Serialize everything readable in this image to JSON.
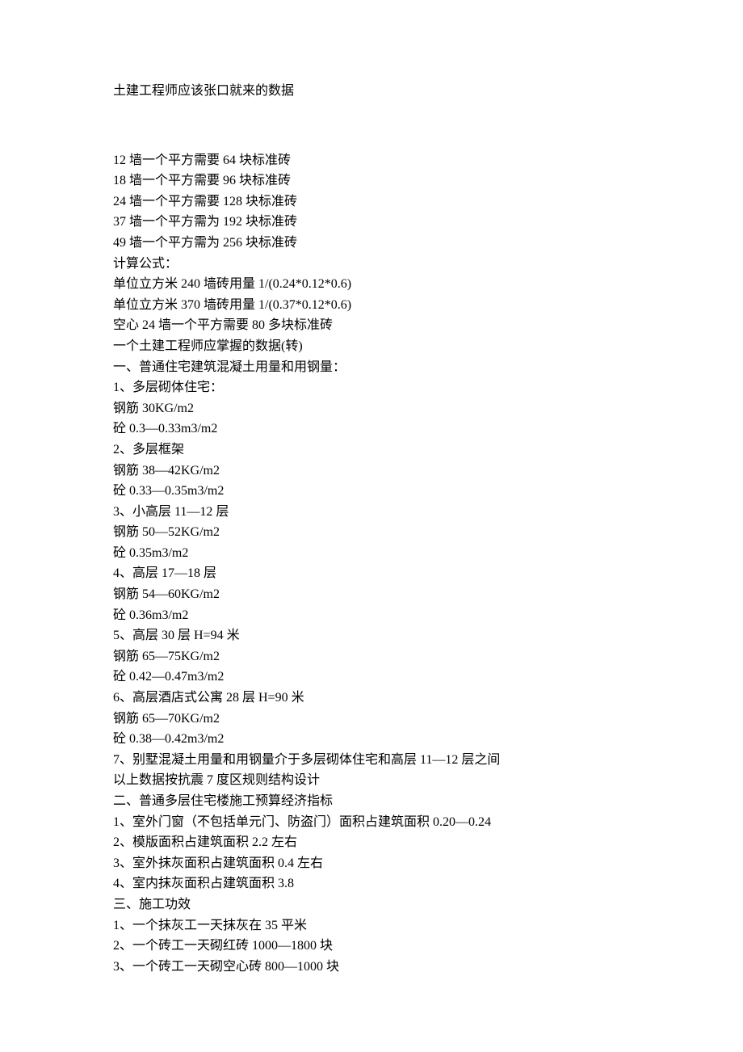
{
  "title": "土建工程师应该张口就来的数据",
  "lines": [
    "12 墙一个平方需要 64 块标准砖",
    "18 墙一个平方需要 96 块标准砖",
    "24 墙一个平方需要 128 块标准砖",
    "37 墙一个平方需为 192 块标准砖",
    "49 墙一个平方需为 256 块标准砖",
    "计算公式：",
    "单位立方米 240 墙砖用量 1/(0.24*0.12*0.6)",
    "单位立方米 370 墙砖用量 1/(0.37*0.12*0.6)",
    "空心 24 墙一个平方需要 80 多块标准砖",
    "一个土建工程师应掌握的数据(转)",
    "一、普通住宅建筑混凝土用量和用钢量：",
    "1、多层砌体住宅：",
    "钢筋 30KG/m2",
    "砼 0.3—0.33m3/m2",
    "2、多层框架",
    "钢筋 38—42KG/m2",
    "砼 0.33—0.35m3/m2",
    "3、小高层 11—12 层",
    "钢筋 50—52KG/m2",
    "砼 0.35m3/m2",
    "4、高层 17—18 层",
    "钢筋 54—60KG/m2",
    "砼 0.36m3/m2",
    "5、高层 30 层 H=94 米",
    "钢筋 65—75KG/m2",
    "砼 0.42—0.47m3/m2",
    "6、高层酒店式公寓 28 层 H=90 米",
    "钢筋 65—70KG/m2",
    "砼 0.38—0.42m3/m2",
    "7、别墅混凝土用量和用钢量介于多层砌体住宅和高层 11—12 层之间",
    "以上数据按抗震 7 度区规则结构设计",
    "二、普通多层住宅楼施工预算经济指标",
    "1、室外门窗（不包括单元门、防盗门）面积占建筑面积 0.20—0.24",
    "2、模版面积占建筑面积 2.2 左右",
    "3、室外抹灰面积占建筑面积 0.4 左右",
    "4、室内抹灰面积占建筑面积 3.8",
    "三、施工功效",
    "1、一个抹灰工一天抹灰在 35 平米",
    "2、一个砖工一天砌红砖 1000—1800 块",
    "3、一个砖工一天砌空心砖 800—1000 块"
  ]
}
